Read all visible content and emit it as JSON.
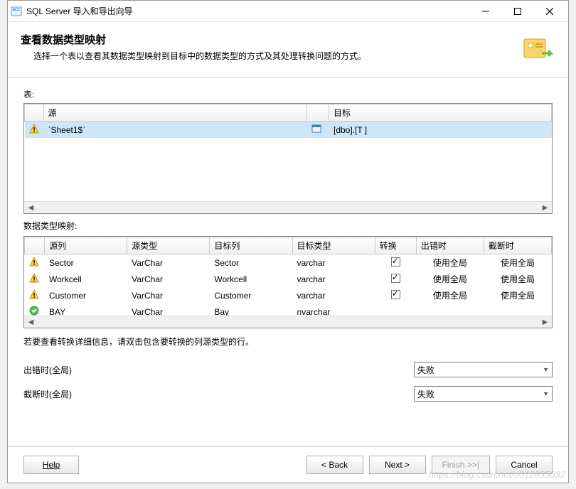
{
  "titlebar": {
    "title": "SQL Server 导入和导出向导"
  },
  "header": {
    "title": "查看数据类型映射",
    "description": "选择一个表以查看其数据类型映射到目标中的数据类型的方式及其处理转换问题的方式。"
  },
  "top_table": {
    "label": "表:",
    "columns": {
      "source": "源",
      "target": "目标"
    },
    "rows": [
      {
        "source": "`Sheet1$`",
        "target": "[dbo].[T                        ]"
      }
    ]
  },
  "mapping_table": {
    "label": "数据类型映射:",
    "columns": {
      "source_col": "源列",
      "source_type": "源类型",
      "target_col": "目标列",
      "target_type": "目标类型",
      "convert": "转换",
      "on_error": "出错时",
      "on_truncate": "截断时"
    },
    "rows": [
      {
        "status": "warn",
        "source_col": "Sector",
        "source_type": "VarChar",
        "target_col": "Sector",
        "target_type": "varchar",
        "convert": true,
        "on_error": "使用全局",
        "on_truncate": "使用全局"
      },
      {
        "status": "warn",
        "source_col": "Workcell",
        "source_type": "VarChar",
        "target_col": "Workcell",
        "target_type": "varchar",
        "convert": true,
        "on_error": "使用全局",
        "on_truncate": "使用全局"
      },
      {
        "status": "warn",
        "source_col": "Customer",
        "source_type": "VarChar",
        "target_col": "Customer",
        "target_type": "varchar",
        "convert": true,
        "on_error": "使用全局",
        "on_truncate": "使用全局"
      },
      {
        "status": "ok",
        "source_col": "BAY",
        "source_type": "VarChar",
        "target_col": "Bay",
        "target_type": "nvarchar",
        "convert": false,
        "on_error": "",
        "on_truncate": ""
      }
    ]
  },
  "hint": "若要查看转换详细信息，请双击包含要转换的列源类型的行。",
  "global": {
    "on_error_label": "出错时(全局)",
    "on_truncate_label": "截断时(全局)",
    "on_error_value": "失败",
    "on_truncate_value": "失败"
  },
  "buttons": {
    "help": "Help",
    "back": "< Back",
    "next": "Next >",
    "finish": "Finish >>|",
    "cancel": "Cancel"
  },
  "watermark": "https://blog.csdn.net/u012835032"
}
